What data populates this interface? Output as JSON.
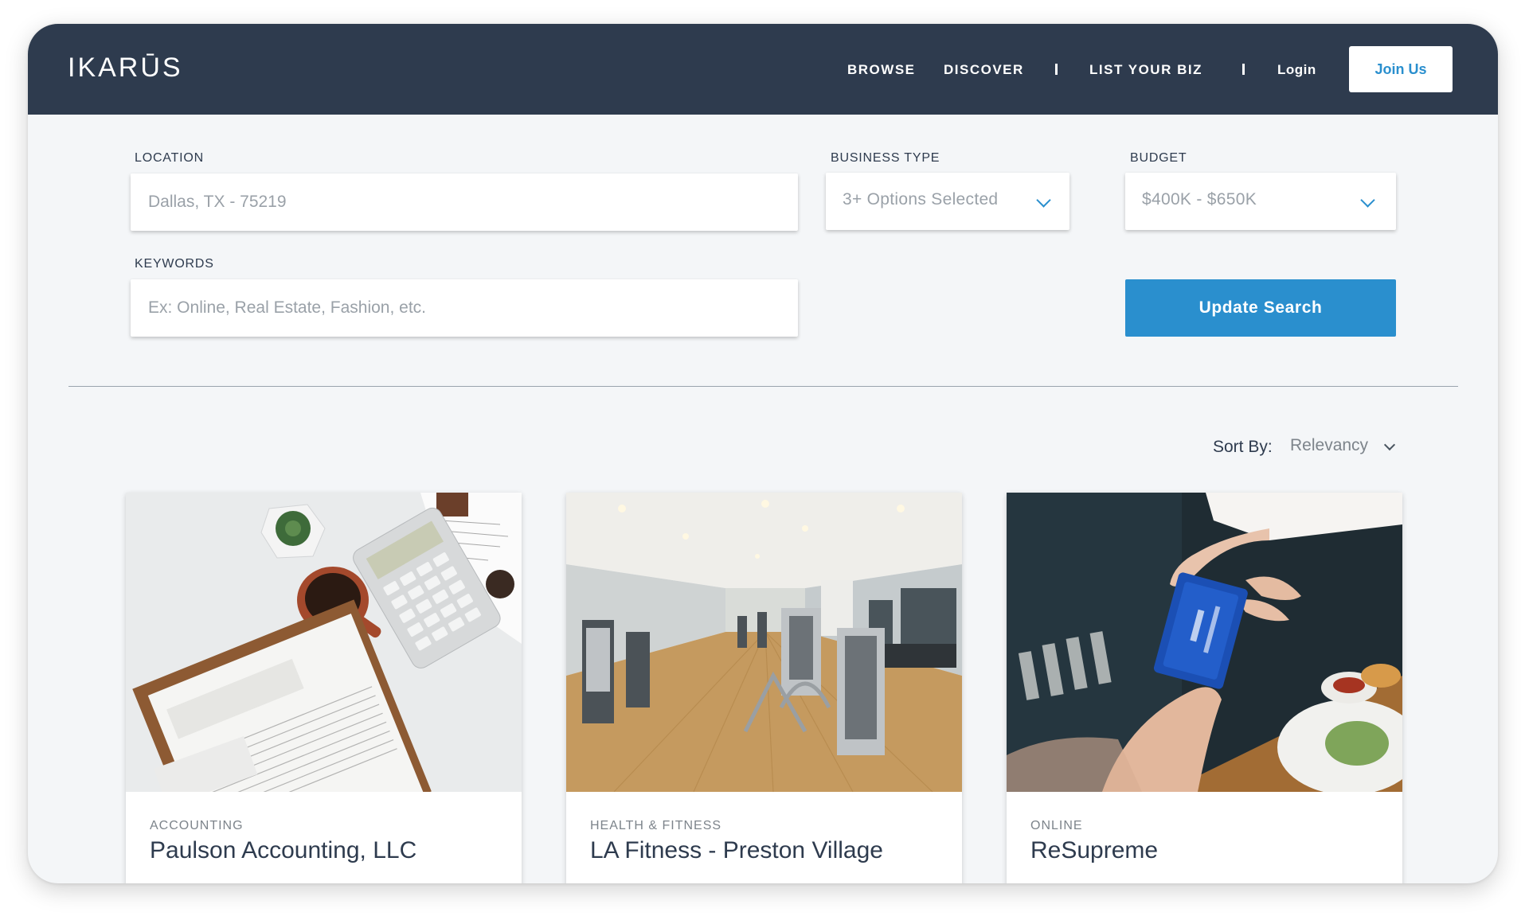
{
  "header": {
    "logo": "IKARŪS",
    "nav": [
      "BROWSE",
      "DISCOVER",
      "LIST YOUR BIZ"
    ],
    "login": "Login",
    "join": "Join Us"
  },
  "search": {
    "location_label": "LOCATION",
    "location_placeholder": "Dallas, TX - 75219",
    "business_type_label": "BUSINESS TYPE",
    "business_type_value": "3+ Options Selected",
    "budget_label": "BUDGET",
    "budget_value": "$400K - $650K",
    "keywords_label": "KEYWORDS",
    "keywords_placeholder": "Ex: Online, Real Estate, Fashion, etc.",
    "update_button": "Update Search"
  },
  "sort": {
    "label": "Sort By:",
    "value": "Relevancy"
  },
  "listings": [
    {
      "category": "ACCOUNTING",
      "title": "Paulson Accounting, LLC",
      "image": "desk-with-newspaper-calculator-coffee"
    },
    {
      "category": "HEALTH & FITNESS",
      "title": "LA Fitness - Preston Village",
      "image": "gym-interior"
    },
    {
      "category": "ONLINE",
      "title": "ReSupreme",
      "image": "credit-card-payment"
    }
  ],
  "colors": {
    "header_bg": "#2e3b4e",
    "accent": "#2a8fce",
    "page_bg": "#f4f6f8"
  }
}
